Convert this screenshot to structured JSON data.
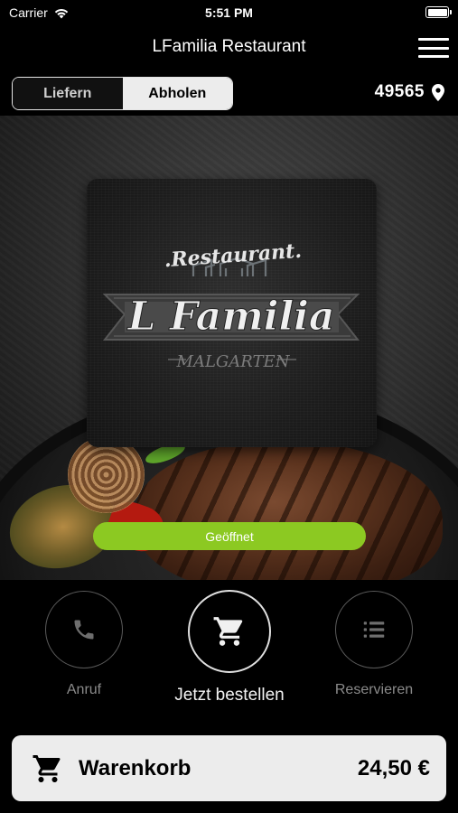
{
  "status_bar": {
    "carrier": "Carrier",
    "time": "5:51 PM"
  },
  "nav": {
    "title": "LFamilia Restaurant"
  },
  "delivery_toggle": {
    "options": [
      "Liefern",
      "Abholen"
    ],
    "selected": "Abholen"
  },
  "location": {
    "zip": "49565"
  },
  "logo": {
    "line1": ".Restaurant.",
    "line2": "L Familia",
    "line3": "MALGARTEN"
  },
  "status_badge": {
    "label": "Geöffnet",
    "color": "#8cc922"
  },
  "actions": [
    {
      "label": "Anruf",
      "icon": "phone-icon"
    },
    {
      "label": "Jetzt bestellen",
      "icon": "cart-icon"
    },
    {
      "label": "Reservieren",
      "icon": "list-icon"
    }
  ],
  "cart": {
    "label": "Warenkorb",
    "total": "24,50 €",
    "icon": "cart-icon"
  }
}
